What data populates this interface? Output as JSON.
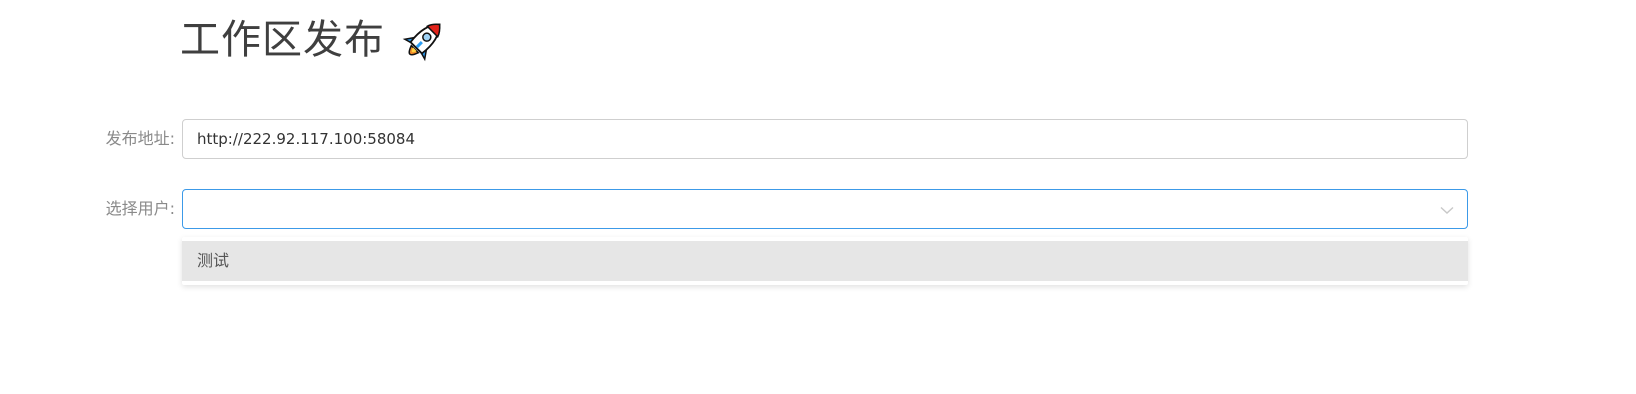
{
  "header": {
    "title": "工作区发布",
    "icon": "rocket-icon"
  },
  "form": {
    "url_label": "发布地址:",
    "url_value": "http://222.92.117.100:58084",
    "user_label": "选择用户:",
    "user_value": "",
    "user_options": [
      "测试"
    ]
  },
  "colors": {
    "focus_border": "#3c9ae8",
    "option_hover": "#e6e6e6",
    "label_text": "#8a8a8a"
  }
}
